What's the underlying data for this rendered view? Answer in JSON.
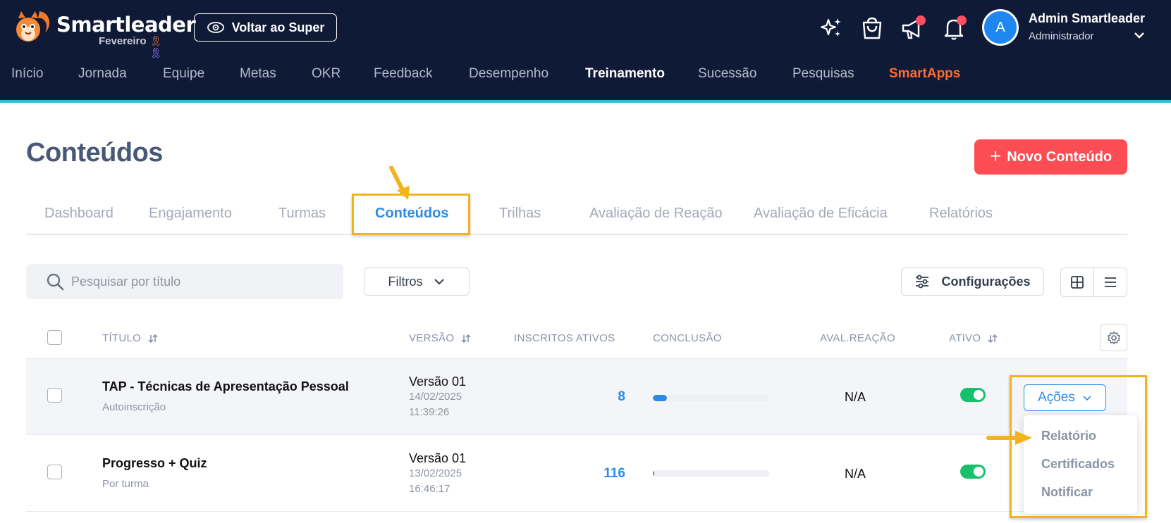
{
  "header": {
    "brand": "Smartleader",
    "month": "Fevereiro",
    "back_button": "Voltar ao Super",
    "user_initial": "A",
    "user_name": "Admin Smartleader",
    "user_role": "Administrador"
  },
  "nav": [
    "Início",
    "Jornada",
    "Equipe",
    "Metas",
    "OKR",
    "Feedback",
    "Desempenho",
    "Treinamento",
    "Sucessão",
    "Pesquisas",
    "SmartApps"
  ],
  "nav_active": "Treinamento",
  "page": {
    "title": "Conteúdos",
    "new_button": "Novo Conteúdo"
  },
  "tabs": [
    "Dashboard",
    "Engajamento",
    "Turmas",
    "Conteúdos",
    "Trilhas",
    "Avaliação de Reação",
    "Avaliação de Eficácia",
    "Relatórios"
  ],
  "tab_active": "Conteúdos",
  "toolbar": {
    "search_placeholder": "Pesquisar por título",
    "filters": "Filtros",
    "config": "Configurações"
  },
  "table": {
    "columns": [
      "TÍTULO",
      "VERSÃO",
      "INSCRITOS ATIVOS",
      "CONCLUSÃO",
      "AVAL.REAÇÃO",
      "ATIVO"
    ],
    "rows": [
      {
        "title": "TAP - Técnicas de Apresentação Pessoal",
        "type": "Autoinscrição",
        "version": "Versão 01",
        "date": "14/02/2025",
        "time": "11:39:26",
        "enrolled": "8",
        "completion": 0.12,
        "reaction": "N/A",
        "active": true
      },
      {
        "title": "Progresso + Quiz",
        "type": "Por turma",
        "version": "Versão 01",
        "date": "13/02/2025",
        "time": "16:46:17",
        "enrolled": "116",
        "completion": 0.01,
        "reaction": "N/A",
        "active": true
      }
    ]
  },
  "actions": {
    "button": "Ações",
    "menu": [
      "Relatório",
      "Certificados",
      "Notificar"
    ]
  },
  "colors": {
    "header_bg": "#0f1a37",
    "accent_blue": "#2d8be6",
    "new_button": "#fc4d54",
    "highlight": "#f3b31c",
    "toggle_on": "#17c06a",
    "smartapps": "#ff6a2f"
  }
}
